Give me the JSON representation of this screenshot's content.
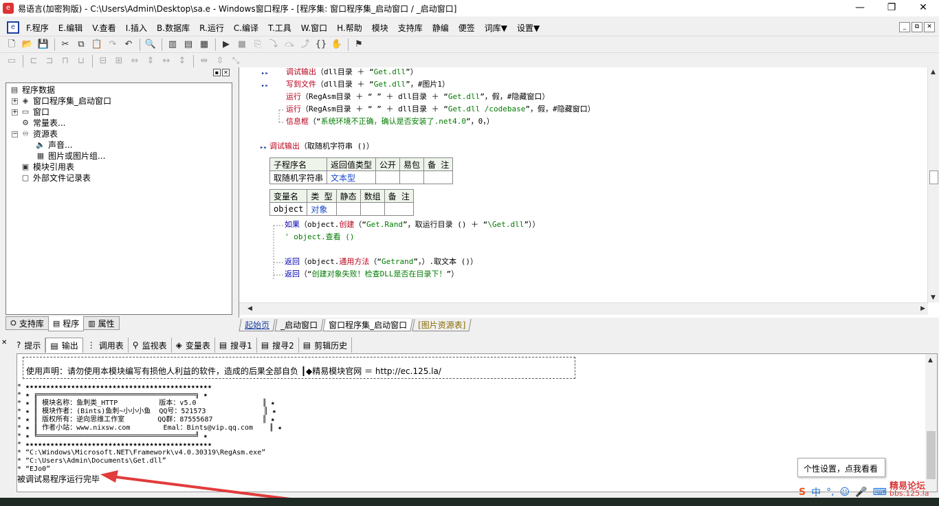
{
  "window": {
    "title": "易语言(加密狗版) - C:\\Users\\Admin\\Desktop\\sa.e - Windows窗口程序 - [程序集: 窗口程序集_启动窗口 / _启动窗口]",
    "minimize": "—",
    "maximize": "❐",
    "close": "✕"
  },
  "menu": {
    "items": [
      "F.程序",
      "E.编辑",
      "V.查看",
      "I.插入",
      "B.数据库",
      "R.运行",
      "C.编译",
      "T.工具",
      "W.窗口",
      "H.帮助",
      "模块",
      "支持库",
      "静编",
      "便签",
      "词库▼",
      "设置▼"
    ],
    "mdi": [
      "_",
      "⧉",
      "✕"
    ]
  },
  "left_panel": {
    "header_buttons": [
      "▪",
      "✕"
    ],
    "tree": [
      {
        "label": "程序数据",
        "icon": "book-icon",
        "glyph": "▤",
        "expander": "",
        "indent": 0
      },
      {
        "label": "窗口程序集_启动窗口",
        "icon": "layers-icon",
        "glyph": "◈",
        "expander": "+",
        "indent": 1
      },
      {
        "label": "窗口",
        "icon": "window-icon",
        "glyph": "▭",
        "expander": "+",
        "indent": 1
      },
      {
        "label": "常量表...",
        "icon": "constant-icon",
        "glyph": "⚙",
        "expander": "",
        "indent": 1
      },
      {
        "label": "资源表",
        "icon": "resource-icon",
        "glyph": "♾",
        "expander": "−",
        "indent": 1
      },
      {
        "label": "声音...",
        "icon": "sound-icon",
        "glyph": "🔈",
        "expander": "",
        "indent": 2
      },
      {
        "label": "图片或图片组...",
        "icon": "picture-icon",
        "glyph": "▦",
        "expander": "",
        "indent": 2
      },
      {
        "label": "模块引用表",
        "icon": "module-icon",
        "glyph": "▣",
        "expander": "",
        "indent": 1
      },
      {
        "label": "外部文件记录表",
        "icon": "file-icon",
        "glyph": "▢",
        "expander": "",
        "indent": 1
      }
    ],
    "tabs": [
      {
        "label": "支持库",
        "glyph": "⛭"
      },
      {
        "label": "程序",
        "glyph": "▤"
      },
      {
        "label": "属性",
        "glyph": "▥"
      }
    ]
  },
  "code": {
    "lines": [
      {
        "parts": [
          [
            "kw",
            "调试输出"
          ],
          [
            "",
            "（dll目录 ＋ “"
          ],
          [
            "str",
            "Get.dll"
          ],
          [
            "",
            "”）"
          ]
        ]
      },
      {
        "parts": [
          [
            "kw",
            "写到文件"
          ],
          [
            "",
            "（dll目录 ＋ “"
          ],
          [
            "str",
            "Get.dll"
          ],
          [
            "",
            "”，#图片1）"
          ]
        ]
      },
      {
        "parts": [
          [
            "kw",
            "运行"
          ],
          [
            "",
            "（RegAsm目录 ＋ “ ” ＋ dll目录 ＋ “"
          ],
          [
            "str",
            "Get.dll"
          ],
          [
            "",
            "”，假，#隐藏窗口）"
          ]
        ]
      },
      {
        "parts": [
          [
            "kw",
            "运行"
          ],
          [
            "",
            "（RegAsm目录 ＋ “ ” ＋ dll目录 ＋ “"
          ],
          [
            "str",
            "Get.dll /codebase"
          ],
          [
            "",
            "”，假，#隐藏窗口）"
          ]
        ]
      },
      {
        "parts": [
          [
            "kw",
            "信息框"
          ],
          [
            "",
            "（“"
          ],
          [
            "str",
            "系统环境不正确，确认是否安装了.net4.0"
          ],
          [
            "",
            "”，0，）"
          ]
        ]
      },
      {
        "parts": [
          [
            "kw",
            "调试输出"
          ],
          [
            "",
            "（取随机字符串 ()）"
          ]
        ]
      },
      {
        "parts": [
          [
            "fn",
            "如果"
          ],
          [
            "",
            "（object."
          ],
          [
            "kw",
            "创建"
          ],
          [
            "",
            "（“"
          ],
          [
            "str",
            "Get.Rand"
          ],
          [
            "",
            "”，取运行目录 () ＋ “"
          ],
          [
            "str",
            "\\Get.dll"
          ],
          [
            "",
            "”））"
          ]
        ]
      },
      {
        "parts": [
          [
            "str",
            "' object.查看 ()"
          ]
        ]
      },
      {
        "parts": [
          [
            "fn",
            "返回"
          ],
          [
            "",
            "（object."
          ],
          [
            "kw",
            "通用方法"
          ],
          [
            "",
            "（“"
          ],
          [
            "str",
            "Getrand"
          ],
          [
            "",
            "”，）.取文本 ()）"
          ]
        ]
      },
      {
        "parts": [
          [
            "fn",
            "返回"
          ],
          [
            "",
            "（“"
          ],
          [
            "str",
            "创建对象失败！检查DLL是否在目录下！"
          ],
          [
            "",
            "”）"
          ]
        ]
      }
    ],
    "sub_table": {
      "headers": [
        "子程序名",
        "返回值类型",
        "公开",
        "易包",
        "备 注"
      ],
      "row": [
        "取随机字符串",
        "文本型",
        "",
        "",
        ""
      ]
    },
    "var_table": {
      "headers": [
        "变量名",
        "类 型",
        "静态",
        "数组",
        "备 注"
      ],
      "row": [
        "object",
        "对象",
        "",
        "",
        ""
      ]
    }
  },
  "editor_tabs": [
    "起始页",
    "_启动窗口",
    "窗口程序集_启动窗口",
    "[图片资源表]"
  ],
  "bottom_tabs": [
    {
      "label": "提示",
      "glyph": "?"
    },
    {
      "label": "输出",
      "glyph": "▤"
    },
    {
      "label": "调用表",
      "glyph": "⋮"
    },
    {
      "label": "监视表",
      "glyph": "⚲"
    },
    {
      "label": "变量表",
      "glyph": "◈"
    },
    {
      "label": "搜寻1",
      "glyph": "▤"
    },
    {
      "label": "搜寻2",
      "glyph": "▤"
    },
    {
      "label": "剪辑历史",
      "glyph": "▤"
    }
  ],
  "output": {
    "disclaimer": "使用声明：请勿使用本模块编写有损他人利益的软件，造成的后果全部自负 ┃◆精易模块官网   ＝ http://ec.125.la/",
    "lines": [
      "* ★★★★★★★★★★★★★★★★★★★★★★★★★★★★★★★★★★★★★★★★★★★★★",
      "* ★ ╔══════════════════════════════════════╗ ★",
      "* ★ ║ 模块名称：鱼刺类_HTTP          版本：v5.0                ║ ★",
      "* ★ ║ 模块作者：(Bints)鱼刺~小小小鱼  QQ号：521573              ║ ★",
      "* ★ ║ 版权所有：逆向思维工作室        QQ群：87555687            ║ ★",
      "* ★ ║ 作者小站：www.nixsw.com        Emal：Bints@vip.qq.com    ║ ★",
      "* ★ ╚══════════════════════════════════════╝ ★",
      "* ★★★★★★★★★★★★★★★★★★★★★★★★★★★★★★★★★★★★★★★★★★★★★",
      "* “C:\\Windows\\Microsoft.NET\\Framework\\v4.0.30319\\RegAsm.exe”",
      "* “C:\\Users\\Admin\\Documents\\Get.dll”",
      "* “EJo0”",
      "被调试易程序运行完毕"
    ]
  },
  "tooltip": "个性设置，点我看看",
  "ime": [
    "S",
    "中",
    "°,",
    "☺",
    "🎤",
    "⌨"
  ],
  "watermark": {
    "top": "精易论坛",
    "bottom": "bbs.125.la"
  },
  "colors": {
    "accent": "#1b3f9e",
    "keyword": "#b8001b",
    "string": "#007a00",
    "arrow": "#e23b3b"
  }
}
